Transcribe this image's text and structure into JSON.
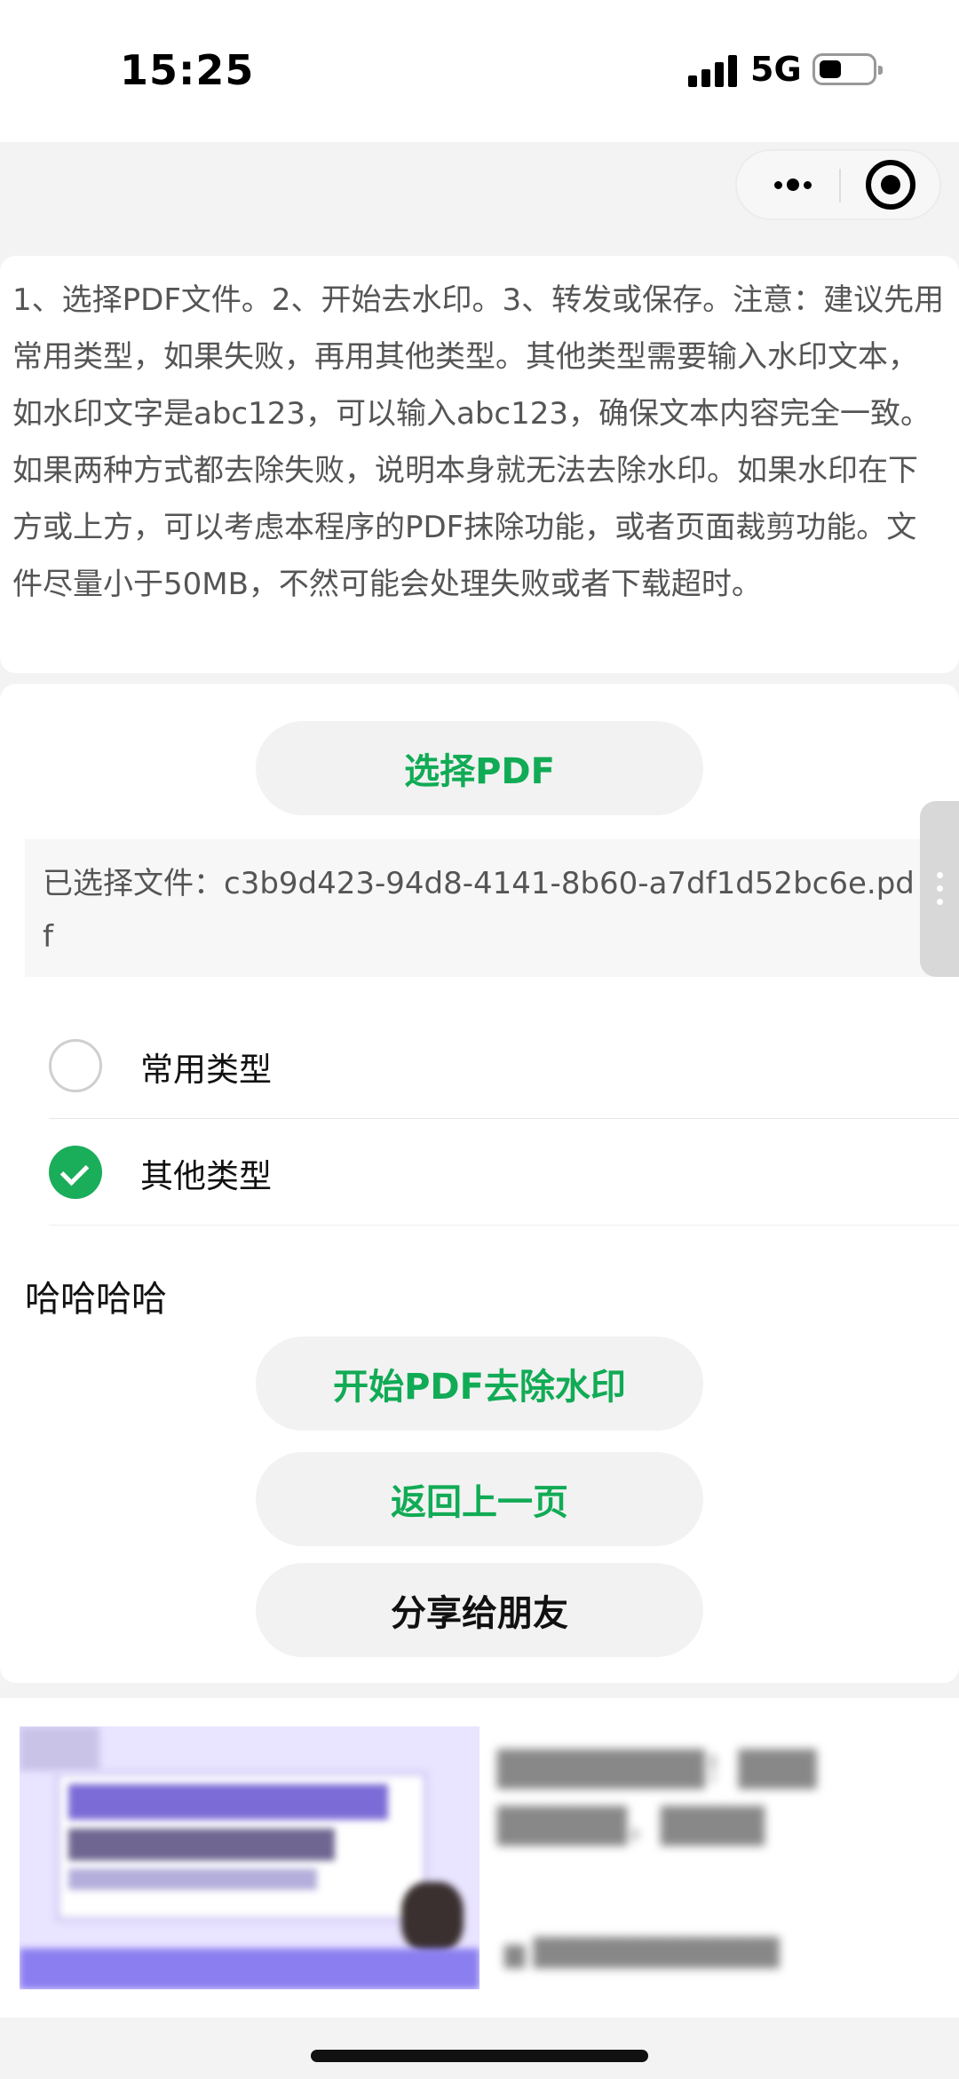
{
  "status_bar": {
    "time": "15:25",
    "network": "5G"
  },
  "capsule": {
    "menu_icon": "more-dots-icon",
    "close_icon": "target-close-icon"
  },
  "instructions": {
    "text": "1、选择PDF文件。2、开始去水印。3、转发或保存。注意：建议先用常用类型，如果失败，再用其他类型。其他类型需要输入水印文本，如水印文字是abc123，可以输入abc123，确保文本内容完全一致。如果两种方式都去除失败，说明本身就无法去除水印。如果水印在下方或上方，可以考虑本程序的PDF抹除功能，或者页面裁剪功能。文件尽量小于50MB，不然可能会处理失败或者下载超时。"
  },
  "select_button": {
    "label": "选择PDF"
  },
  "selected_file": {
    "text": "已选择文件：c3b9d423-94d8-4141-8b60-a7df1d52bc6e.pdf"
  },
  "options": [
    {
      "label": "常用类型",
      "checked": false
    },
    {
      "label": "其他类型",
      "checked": true
    }
  ],
  "watermark_text": "哈哈哈哈",
  "actions": {
    "start": "开始PDF去除水印",
    "back": "返回上一页",
    "share": "分享给朋友"
  },
  "colors": {
    "accent": "#11ab55",
    "check": "#1aad5a"
  }
}
